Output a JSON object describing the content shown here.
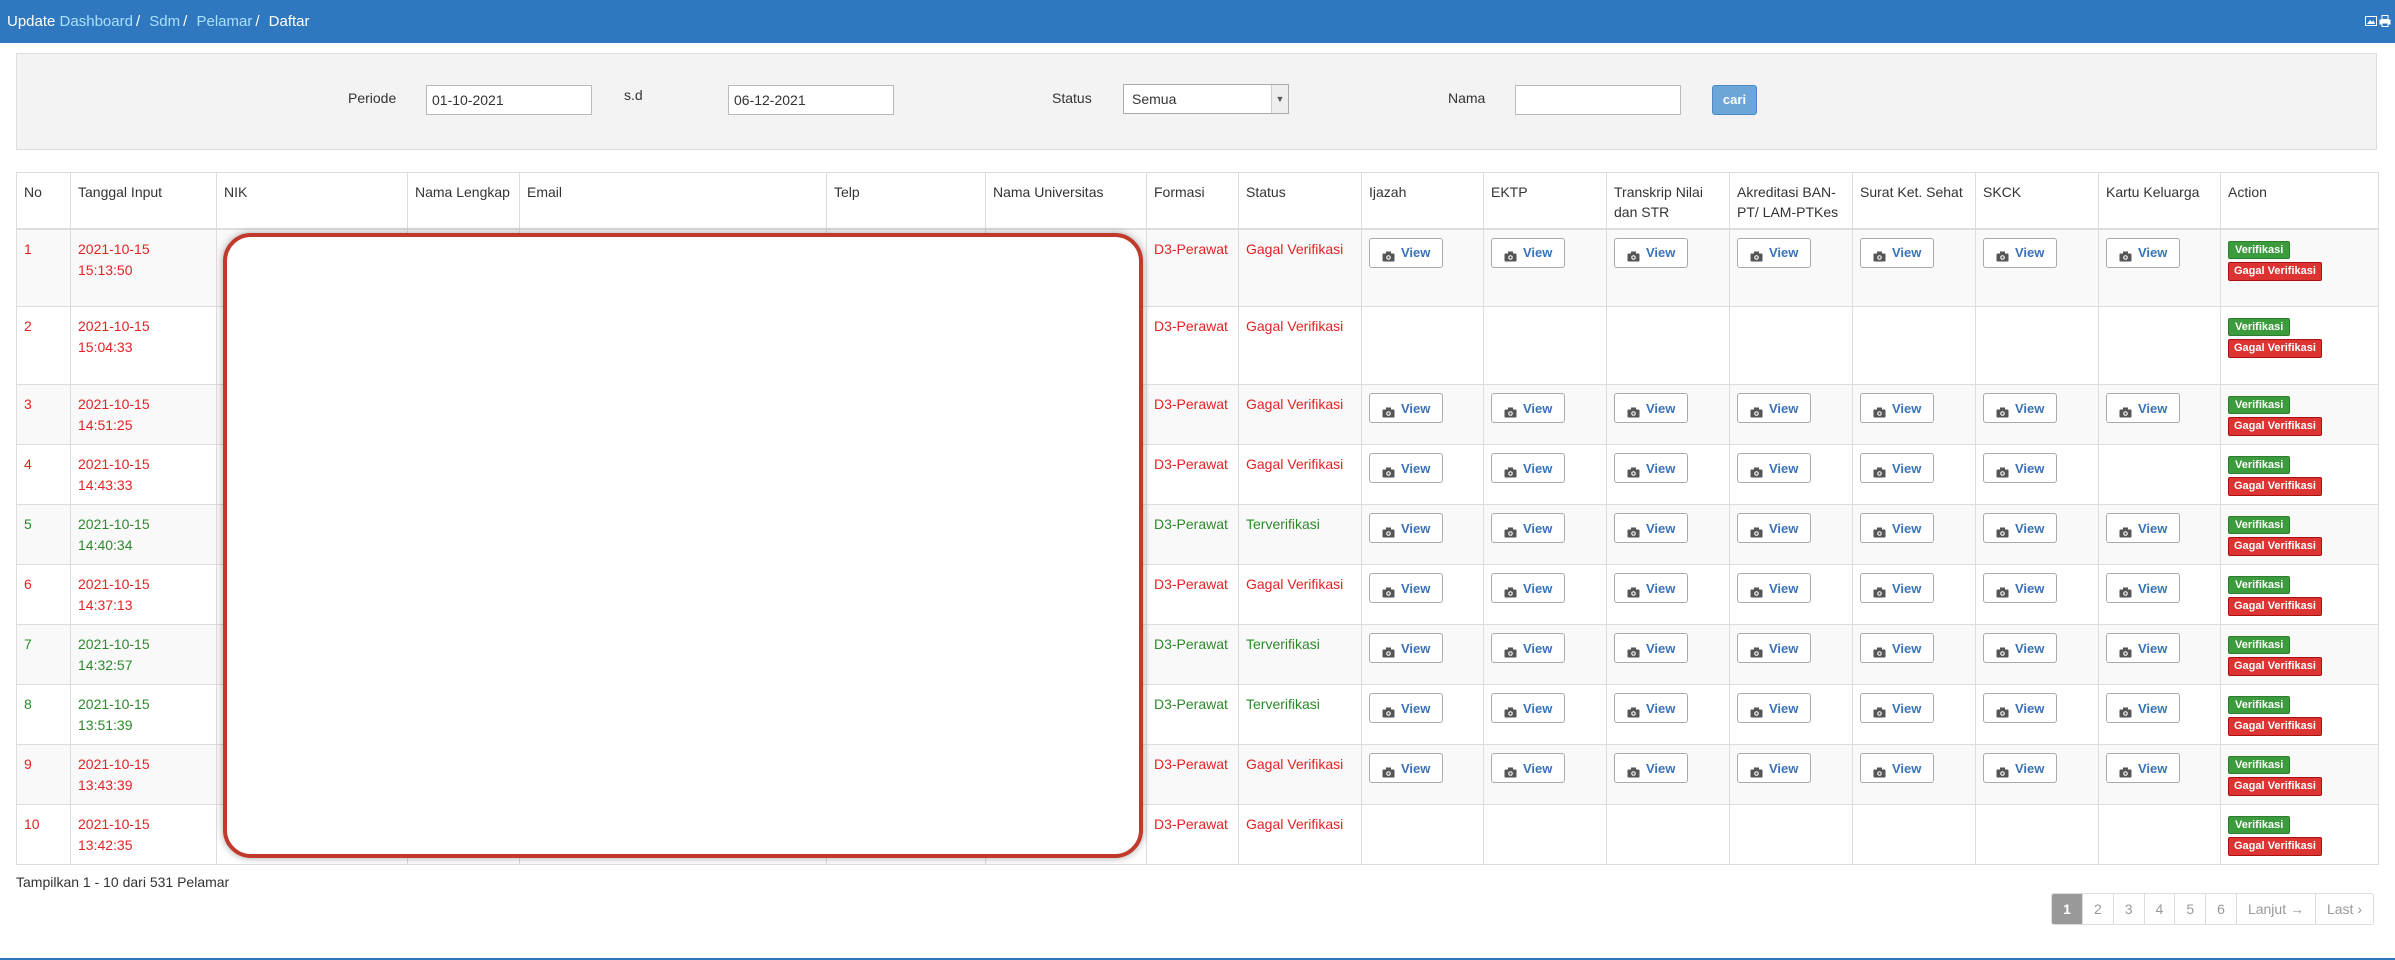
{
  "breadcrumb": {
    "prefix": "Update",
    "items": [
      "Dashboard",
      "Sdm",
      "Pelamar"
    ],
    "current": "Daftar",
    "separator": "/"
  },
  "filter": {
    "periode_label": "Periode",
    "periode_from": "01-10-2021",
    "sd_label": "s.d",
    "periode_to": "06-12-2021",
    "status_label": "Status",
    "status_value": "Semua",
    "nama_label": "Nama",
    "nama_value": "",
    "cari_label": "cari"
  },
  "table": {
    "columns": [
      "No",
      "Tanggal Input",
      "NIK",
      "Nama Lengkap",
      "Email",
      "Telp",
      "Nama Universitas",
      "Formasi",
      "Status",
      "Ijazah",
      "EKTP",
      "Transkrip Nilai dan STR",
      "Akreditasi BAN-PT/ LAM-PTKes",
      "Surat Ket. Sehat",
      "SKCK",
      "Kartu Keluarga",
      "Action"
    ],
    "view_label": "View",
    "verify_label": "Verifikasi",
    "fail_label": "Gagal Verifikasi",
    "rows": [
      {
        "no": "1",
        "date": "2021-10-15",
        "time": "15:13:50",
        "formasi": "D3-Perawat",
        "status": "Gagal Verifikasi",
        "ok": false,
        "docs": [
          true,
          true,
          true,
          true,
          true,
          true,
          true
        ]
      },
      {
        "no": "2",
        "date": "2021-10-15",
        "time": "15:04:33",
        "formasi": "D3-Perawat",
        "status": "Gagal Verifikasi",
        "ok": false,
        "docs": [
          false,
          false,
          false,
          false,
          false,
          false,
          false
        ]
      },
      {
        "no": "3",
        "date": "2021-10-15",
        "time": "14:51:25",
        "formasi": "D3-Perawat",
        "status": "Gagal Verifikasi",
        "ok": false,
        "docs": [
          true,
          true,
          true,
          true,
          true,
          true,
          true
        ]
      },
      {
        "no": "4",
        "date": "2021-10-15",
        "time": "14:43:33",
        "formasi": "D3-Perawat",
        "status": "Gagal Verifikasi",
        "ok": false,
        "docs": [
          true,
          true,
          true,
          true,
          true,
          true,
          false
        ]
      },
      {
        "no": "5",
        "date": "2021-10-15",
        "time": "14:40:34",
        "formasi": "D3-Perawat",
        "status": "Terverifikasi",
        "ok": true,
        "docs": [
          true,
          true,
          true,
          true,
          true,
          true,
          true
        ]
      },
      {
        "no": "6",
        "date": "2021-10-15",
        "time": "14:37:13",
        "formasi": "D3-Perawat",
        "status": "Gagal Verifikasi",
        "ok": false,
        "docs": [
          true,
          true,
          true,
          true,
          true,
          true,
          true
        ]
      },
      {
        "no": "7",
        "date": "2021-10-15",
        "time": "14:32:57",
        "formasi": "D3-Perawat",
        "status": "Terverifikasi",
        "ok": true,
        "docs": [
          true,
          true,
          true,
          true,
          true,
          true,
          true
        ]
      },
      {
        "no": "8",
        "date": "2021-10-15",
        "time": "13:51:39",
        "formasi": "D3-Perawat",
        "status": "Terverifikasi",
        "ok": true,
        "docs": [
          true,
          true,
          true,
          true,
          true,
          true,
          true
        ]
      },
      {
        "no": "9",
        "date": "2021-10-15",
        "time": "13:43:39",
        "formasi": "D3-Perawat",
        "status": "Gagal Verifikasi",
        "ok": false,
        "docs": [
          true,
          true,
          true,
          true,
          true,
          true,
          true
        ]
      },
      {
        "no": "10",
        "date": "2021-10-15",
        "time": "13:42:35",
        "formasi": "D3-Perawat",
        "status": "Gagal Verifikasi",
        "ok": false,
        "docs": [
          false,
          false,
          false,
          false,
          false,
          false,
          false
        ]
      }
    ]
  },
  "summary": "Tampilkan 1 - 10 dari 531 Pelamar",
  "pagination": {
    "pages": [
      "1",
      "2",
      "3",
      "4",
      "5",
      "6"
    ],
    "active": "1",
    "next": "Lanjut →",
    "last": "Last ›"
  },
  "colors": {
    "header_bar": "#2f78c0",
    "error": "#e52222",
    "success": "#2a8a2a",
    "redaction_border": "#c0392b"
  },
  "icons": [
    "image-icon",
    "print-icon",
    "camera-icon"
  ]
}
